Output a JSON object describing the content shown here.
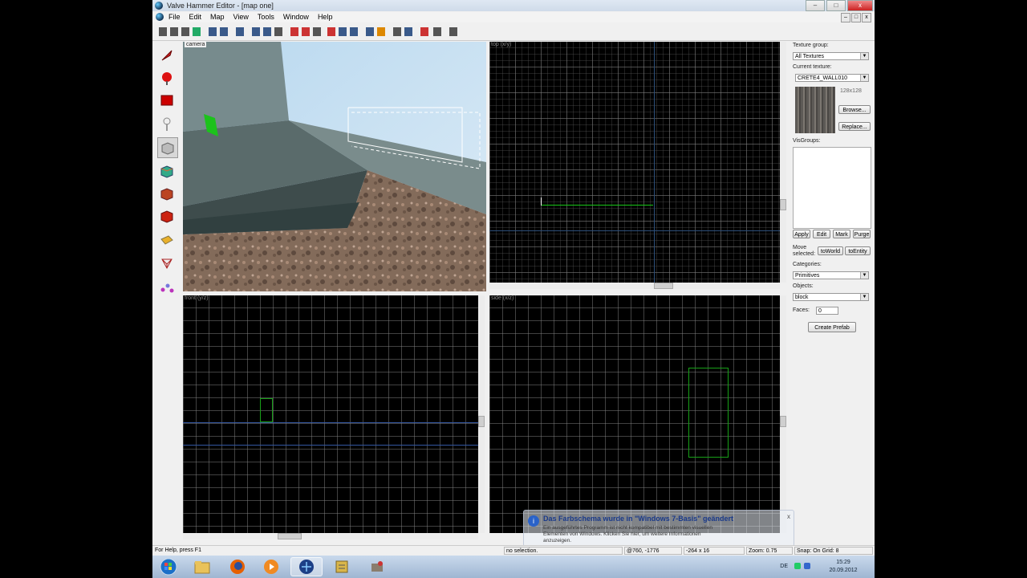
{
  "window": {
    "title": "Valve Hammer Editor - [map one]"
  },
  "window_buttons": {
    "minimize": "–",
    "maximize": "□",
    "close": "x"
  },
  "menu": [
    "File",
    "Edit",
    "Map",
    "View",
    "Tools",
    "Window",
    "Help"
  ],
  "viewports": {
    "camera": "camera",
    "top": "top (x/y)",
    "front": "front (y/z)",
    "side": "side (x/z)"
  },
  "tools": [
    {
      "name": "selection-tool",
      "icon": "pointer-icon"
    },
    {
      "name": "magnify-tool",
      "icon": "magnify-icon"
    },
    {
      "name": "camera-tool",
      "icon": "camera-icon"
    },
    {
      "name": "entity-tool",
      "icon": "entity-icon"
    },
    {
      "name": "block-tool",
      "icon": "block-icon"
    },
    {
      "name": "texture-tool",
      "icon": "texture-icon"
    },
    {
      "name": "apply-texture-tool",
      "icon": "apply-texture-icon"
    },
    {
      "name": "decal-tool",
      "icon": "decal-icon"
    },
    {
      "name": "clip-tool",
      "icon": "clip-icon"
    },
    {
      "name": "vertex-tool",
      "icon": "vertex-icon"
    },
    {
      "name": "path-tool",
      "icon": "path-icon"
    }
  ],
  "right_panel": {
    "texture_group_label": "Texture group:",
    "texture_group_value": "All Textures",
    "current_texture_label": "Current texture:",
    "current_texture_value": "CRETE4_WALL010",
    "texture_size": "128x128",
    "browse_button": "Browse...",
    "replace_button": "Replace...",
    "visgroups_label": "VisGroups:",
    "apply_button": "Apply",
    "edit_button": "Edit",
    "mark_button": "Mark",
    "purge_button": "Purge",
    "move_selected_label": "Move selected:",
    "to_world_button": "toWorld",
    "to_entity_button": "toEntity",
    "categories_label": "Categories:",
    "categories_value": "Primitives",
    "objects_label": "Objects:",
    "objects_value": "block",
    "faces_label": "Faces:",
    "faces_value": "0",
    "create_prefab_button": "Create Prefab"
  },
  "status": {
    "help": "For Help, press F1",
    "selection": "no selection.",
    "coords": "@760, -1776",
    "size": "-264 x 16",
    "zoom": "Zoom: 0.75",
    "snap": "Snap: On Grid: 8"
  },
  "notification": {
    "title": "Das Farbschema wurde in \"Windows 7-Basis\" geändert",
    "line1": "Ein ausgeführtes Programm ist nicht kompatibel mit bestimmten visuellen",
    "line2": "Elementen von Windows. Klicken Sie hier, um weitere Informationen",
    "line3": "anzuzeigen."
  },
  "taskbar": {
    "apps": [
      {
        "name": "start-button",
        "icon": "windows-start-icon"
      },
      {
        "name": "taskbar-explorer",
        "icon": "folder-icon"
      },
      {
        "name": "taskbar-firefox",
        "icon": "firefox-icon"
      },
      {
        "name": "taskbar-media",
        "icon": "media-player-icon"
      },
      {
        "name": "taskbar-hammer",
        "icon": "hammer-editor-icon"
      },
      {
        "name": "taskbar-app",
        "icon": "app-icon"
      },
      {
        "name": "taskbar-tool",
        "icon": "tool-icon"
      }
    ],
    "lang": "DE",
    "time": "15:29",
    "date": "20.09.2012"
  }
}
